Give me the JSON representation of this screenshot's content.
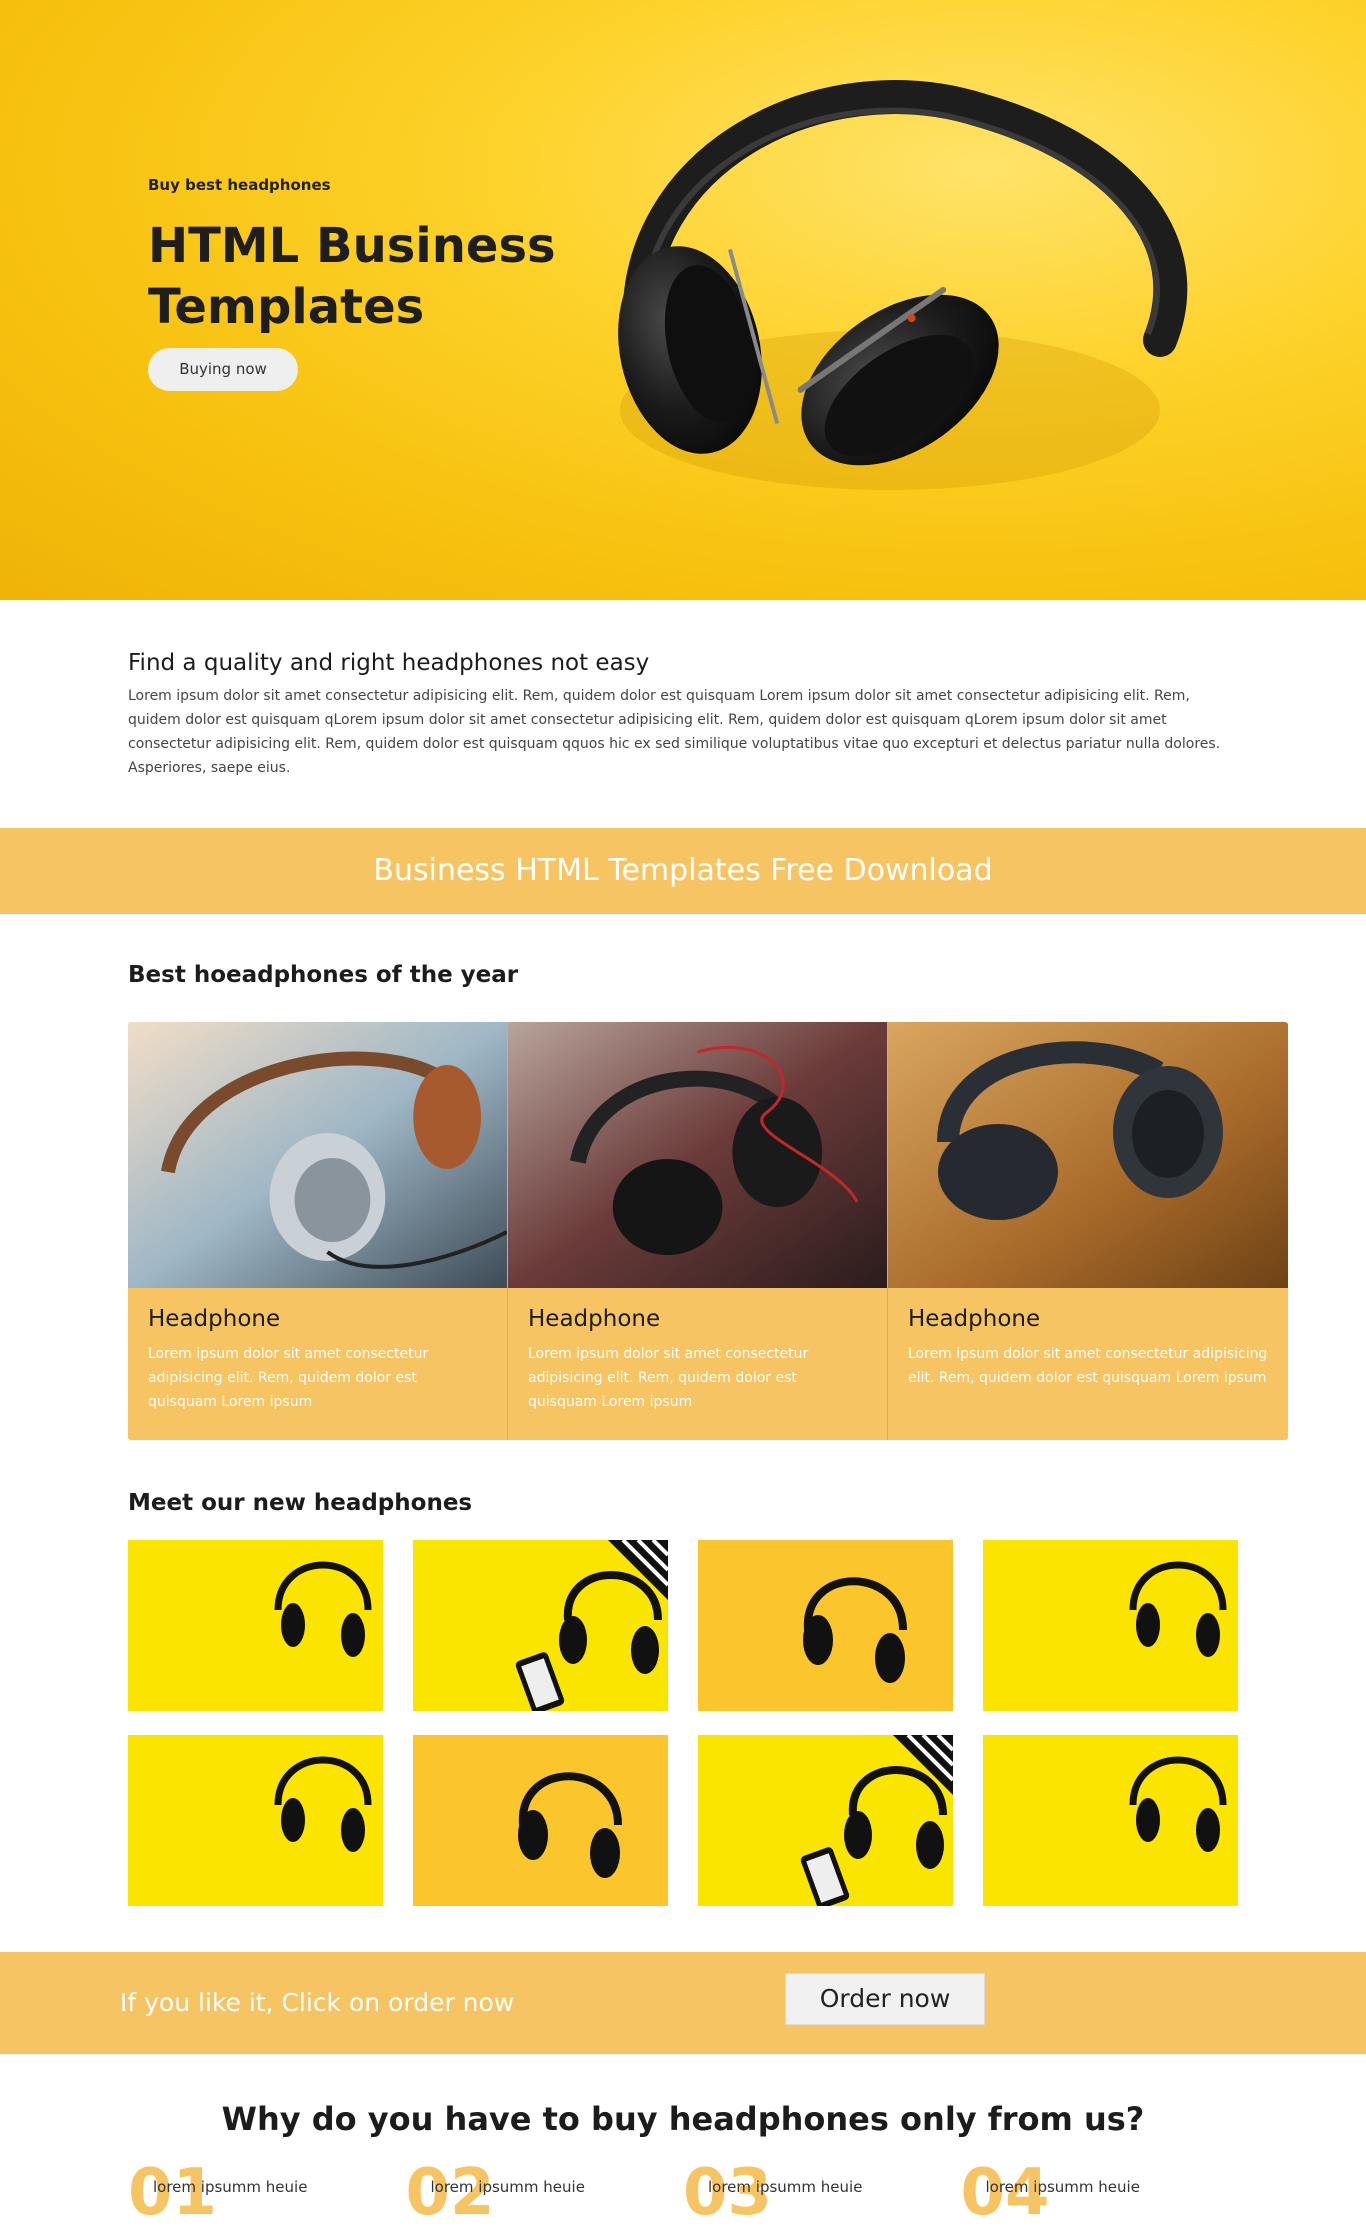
{
  "hero": {
    "kicker": "Buy best headphones",
    "title": "HTML Business Templates",
    "button": "Buying now"
  },
  "intro": {
    "heading": "Find a quality and right headphones not easy",
    "text": "Lorem ipsum dolor sit amet consectetur adipisicing elit. Rem, quidem dolor est quisquam Lorem ipsum dolor sit amet consectetur adipisicing elit. Rem, quidem dolor est quisquam qLorem ipsum dolor sit amet consectetur adipisicing elit. Rem, quidem dolor est quisquam qLorem ipsum dolor sit amet consectetur adipisicing elit. Rem, quidem dolor est quisquam qquos hic ex sed similique voluptatibus vitae quo excepturi et delectus pariatur nulla dolores. Asperiores, saepe eius."
  },
  "banner": {
    "text": "Business HTML Templates Free Download"
  },
  "best": {
    "heading": "Best hoeadphones of the year",
    "cards": [
      {
        "title": "Headphone",
        "text": "Lorem ipsum dolor sit amet consectetur adipisicing elit. Rem, quidem dolor est quisquam Lorem ipsum"
      },
      {
        "title": "Headphone",
        "text": "Lorem ipsum dolor sit amet consectetur adipisicing elit. Rem, quidem dolor est quisquam Lorem ipsum"
      },
      {
        "title": "Headphone",
        "text": "Lorem ipsum dolor sit amet consectetur adipisicing elit. Rem, quidem dolor est quisquam Lorem ipsum"
      }
    ]
  },
  "gallery": {
    "heading": "Meet our new headphones"
  },
  "order": {
    "text": "If you like it, Click on order now",
    "button": "Order now"
  },
  "why": {
    "heading": "Why do you have to buy headphones only from us?",
    "steps": [
      {
        "num": "01",
        "text": "lorem ipsumm heuie"
      },
      {
        "num": "02",
        "text": "lorem ipsumm heuie"
      },
      {
        "num": "03",
        "text": "lorem ipsumm heuie"
      },
      {
        "num": "04",
        "text": "lorem ipsumm heuie"
      }
    ]
  },
  "colors": {
    "accent": "#f7c463",
    "hero_yellow": "#fdd22a",
    "text_dark": "#1c1c1c"
  }
}
